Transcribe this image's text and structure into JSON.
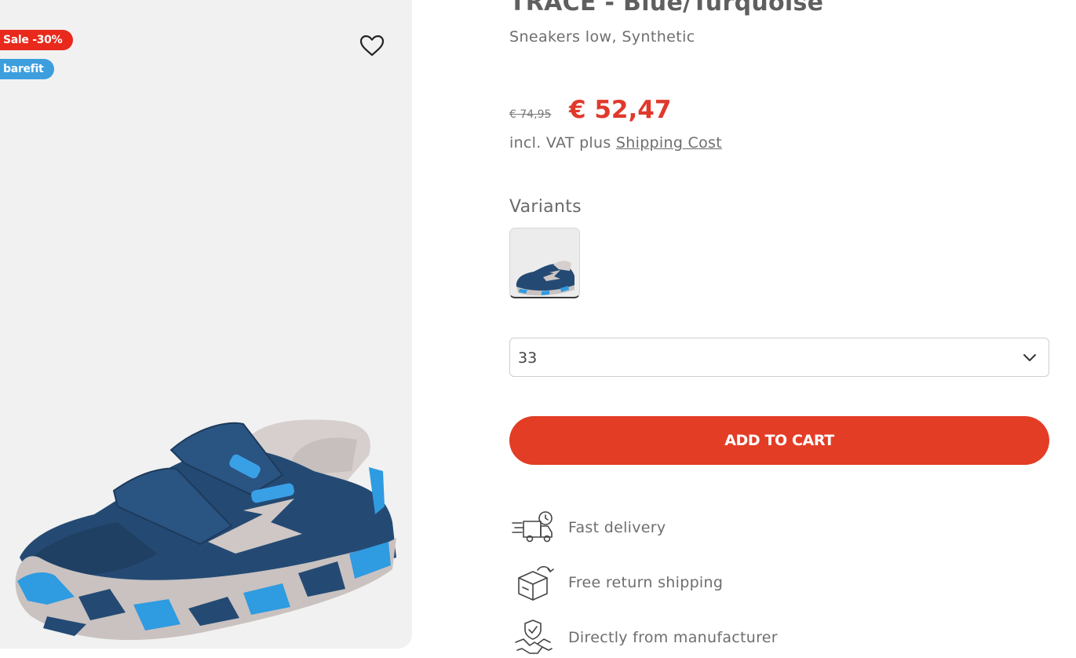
{
  "badges": {
    "sale": "Sale -30%",
    "barefit": "barefit"
  },
  "product": {
    "title": "TRACE - Blue/Turquoise",
    "subtitle": "Sneakers low, Synthetic",
    "price_old": "€ 74,95",
    "price_new": "€ 52,47",
    "vat_prefix": "incl. VAT plus",
    "shipping_link": "Shipping Cost"
  },
  "variants": {
    "heading": "Variants"
  },
  "size_select": {
    "value": "33"
  },
  "cart": {
    "button_label": "ADD TO CART"
  },
  "features": [
    {
      "label": "Fast delivery",
      "icon": "delivery-truck-icon"
    },
    {
      "label": "Free return shipping",
      "icon": "return-box-icon"
    },
    {
      "label": "Directly from manufacturer",
      "icon": "handshake-shield-icon"
    }
  ],
  "colors": {
    "gallery_bg": "#f1f1f1",
    "sale_badge": "#e8291c",
    "barefit_badge": "#3d9ede",
    "price_new": "#e0392b",
    "cart_button": "#e33d26",
    "shoe_main": "#244a74",
    "shoe_accent": "#2f9be0"
  },
  "icons": {
    "wishlist": "heart-outline-icon",
    "select": "chevron-down-icon"
  }
}
